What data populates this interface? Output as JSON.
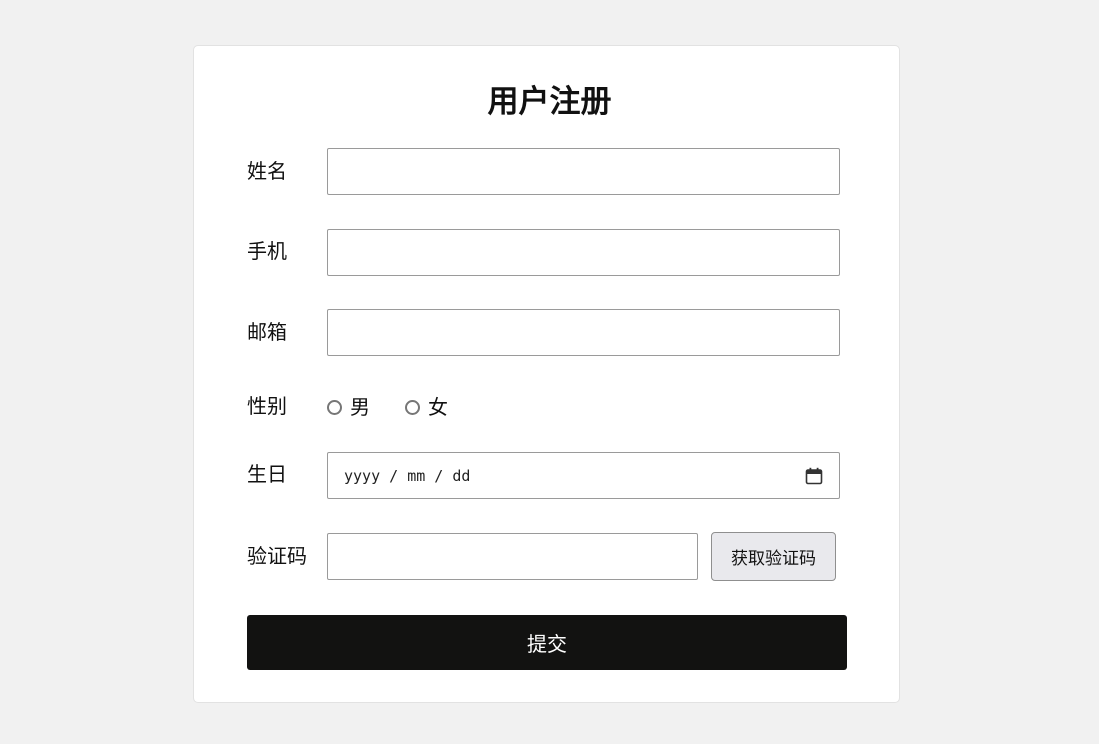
{
  "form": {
    "title": "用户注册",
    "name_label": "姓名",
    "name_value": "",
    "phone_label": "手机",
    "phone_value": "",
    "email_label": "邮箱",
    "email_value": "",
    "gender_label": "性别",
    "gender_options": [
      "男",
      "女"
    ],
    "gender_selected": null,
    "birthday_label": "生日",
    "birthday_placeholder": "yyyy / mm / dd",
    "code_label": "验证码",
    "code_value": "",
    "get_code_button": "获取验证码",
    "submit_button": "提交"
  },
  "icons": {
    "radio": "radio-unchecked-icon",
    "date_picker": "calendar-icon"
  },
  "colors": {
    "page_background": "#f1f1f1",
    "card_background": "#ffffff",
    "submit_background": "#121211",
    "submit_text": "#ffffff",
    "code_button_background": "#e9e9ed",
    "input_border": "#9a9a9a"
  }
}
